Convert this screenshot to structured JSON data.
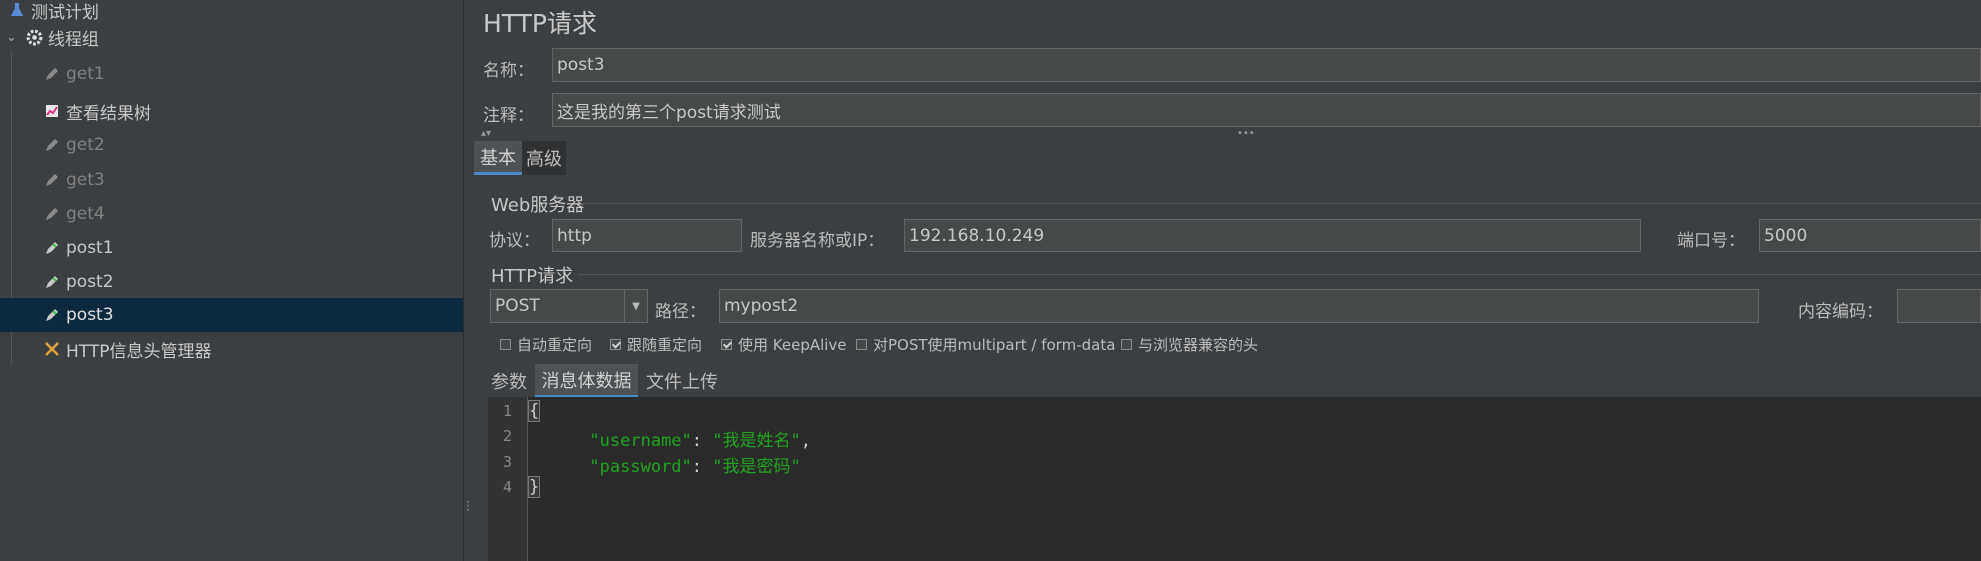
{
  "tree": {
    "items": [
      {
        "label": "测试计划",
        "icon": "flask-icon",
        "state": "enabled"
      },
      {
        "label": "线程组",
        "icon": "gear-icon",
        "state": "enabled",
        "expanded": true
      },
      {
        "label": "get1",
        "icon": "pencil-icon",
        "state": "disabled"
      },
      {
        "label": "查看结果树",
        "icon": "chart-icon",
        "state": "enabled"
      },
      {
        "label": "get2",
        "icon": "pencil-icon",
        "state": "disabled"
      },
      {
        "label": "get3",
        "icon": "pencil-icon",
        "state": "disabled"
      },
      {
        "label": "get4",
        "icon": "pencil-icon",
        "state": "disabled"
      },
      {
        "label": "post1",
        "icon": "pencil-icon",
        "state": "enabled"
      },
      {
        "label": "post2",
        "icon": "pencil-icon",
        "state": "enabled"
      },
      {
        "label": "post3",
        "icon": "pencil-icon",
        "state": "selected"
      },
      {
        "label": "HTTP信息头管理器",
        "icon": "wrench-icon",
        "state": "enabled"
      }
    ]
  },
  "panel": {
    "title": "HTTP请求",
    "name_label": "名称：",
    "name_value": "post3",
    "comment_label": "注释：",
    "comment_value": "这是我的第三个post请求测试",
    "tabs": [
      "基本",
      "高级"
    ],
    "web_server": {
      "section": "Web服务器",
      "protocol_label": "协议：",
      "protocol_value": "http",
      "server_label": "服务器名称或IP：",
      "server_value": "192.168.10.249",
      "port_label": "端口号：",
      "port_value": "5000"
    },
    "http_request": {
      "section": "HTTP请求",
      "method": "POST",
      "path_label": "路径：",
      "path_value": "mypost2",
      "encoding_label": "内容编码：",
      "encoding_value": ""
    },
    "options": [
      {
        "label": "自动重定向",
        "checked": false
      },
      {
        "label": "跟随重定向",
        "checked": true
      },
      {
        "label": "使用 KeepAlive",
        "checked": true
      },
      {
        "label": "对POST使用multipart / form-data",
        "checked": false
      },
      {
        "label": "与浏览器兼容的头",
        "checked": false
      }
    ],
    "body_tabs": [
      "参数",
      "消息体数据",
      "文件上传"
    ],
    "body": {
      "line_numbers": [
        "1",
        "2",
        "3",
        "4"
      ],
      "open_brace": "{",
      "username_key": "\"username\"",
      "username_value": "\"我是姓名\"",
      "password_key": "\"password\"",
      "password_value": "\"我是密码\"",
      "close_brace": "}"
    }
  },
  "colors": {
    "background": "#3c3f41",
    "selection": "#0d293e",
    "accent": "#4a88c7",
    "string": "#1fa31f"
  }
}
